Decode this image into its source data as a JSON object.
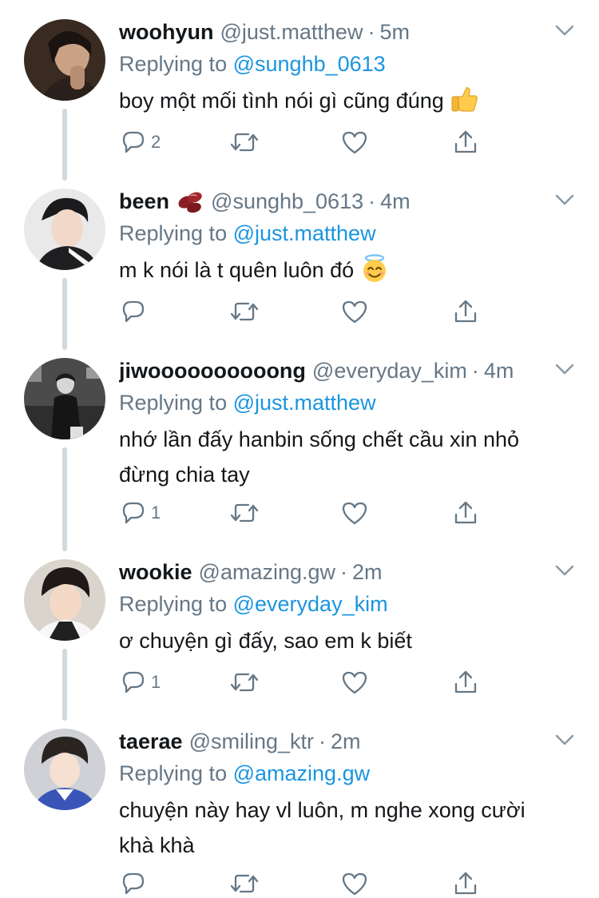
{
  "tweets": [
    {
      "display_name": "woohyun",
      "handle": "@just.matthew",
      "separator": "·",
      "time": "5m",
      "replying_prefix": "Replying to",
      "replying_to": "@sunghb_0613",
      "lines": [
        "boy một mối tình nói gì cũng đúng"
      ],
      "emoji": "thumbs-up",
      "reply_count": "2",
      "avatar": "profile-photo"
    },
    {
      "display_name": "been",
      "name_emoji": "beans",
      "handle": "@sunghb_0613",
      "separator": "·",
      "time": "4m",
      "replying_prefix": "Replying to",
      "replying_to": "@just.matthew",
      "lines": [
        "m k nói là t quên luôn đó"
      ],
      "emoji": "smiling-face-with-halo",
      "reply_count": "",
      "avatar": "profile-photo"
    },
    {
      "display_name": "jiwoooooooooong",
      "handle": "@everyday_kim",
      "separator": "·",
      "time": "4m",
      "replying_prefix": "Replying to",
      "replying_to": "@just.matthew",
      "lines": [
        "nhớ lần đấy hanbin sống chết cầu xin nhỏ",
        "đừng chia tay"
      ],
      "emoji": "",
      "reply_count": "1",
      "avatar": "profile-photo"
    },
    {
      "display_name": "wookie",
      "handle": "@amazing.gw",
      "separator": "·",
      "time": "2m",
      "replying_prefix": "Replying to",
      "replying_to": "@everyday_kim",
      "lines": [
        "ơ chuyện gì đấy, sao em k biết"
      ],
      "emoji": "",
      "reply_count": "1",
      "avatar": "profile-photo"
    },
    {
      "display_name": "taerae",
      "handle": "@smiling_ktr",
      "separator": "·",
      "time": "2m",
      "replying_prefix": "Replying to",
      "replying_to": "@amazing.gw",
      "lines": [
        "chuyện này hay vl luôn, m nghe xong cười",
        "khà khà"
      ],
      "emoji": "",
      "reply_count": "",
      "avatar": "profile-photo"
    }
  ],
  "icons": {
    "reply": "reply-icon",
    "retweet": "retweet-icon",
    "like": "heart-icon",
    "share": "share-icon",
    "menu": "chevron-down-icon"
  },
  "colors": {
    "text": "#14171a",
    "secondary": "#657786",
    "link": "#1b95e0",
    "thread_line": "#cfd9de"
  }
}
